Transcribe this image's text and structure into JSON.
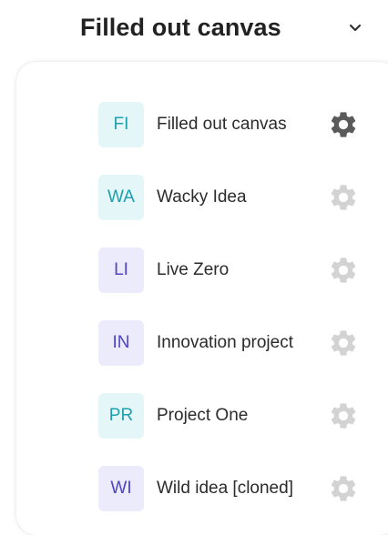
{
  "selector": {
    "label": "Filled out canvas",
    "chevron_icon": "chevron-down-icon"
  },
  "canvases": [
    {
      "initials": "FI",
      "name": "Filled out canvas",
      "badge_color": "teal",
      "settings_icon": "gear-icon",
      "settings_state": "active"
    },
    {
      "initials": "WA",
      "name": "Wacky Idea",
      "badge_color": "teal",
      "settings_icon": "gear-icon",
      "settings_state": "muted"
    },
    {
      "initials": "LI",
      "name": "Live Zero",
      "badge_color": "purple",
      "settings_icon": "gear-icon",
      "settings_state": "muted"
    },
    {
      "initials": "IN",
      "name": "Innovation project",
      "badge_color": "purple",
      "settings_icon": "gear-icon",
      "settings_state": "muted"
    },
    {
      "initials": "PR",
      "name": "Project One",
      "badge_color": "teal",
      "settings_icon": "gear-icon",
      "settings_state": "muted"
    },
    {
      "initials": "WI",
      "name": "Wild idea [cloned]",
      "badge_color": "purple",
      "settings_icon": "gear-icon",
      "settings_state": "muted"
    }
  ],
  "colors": {
    "teal_bg": "#e4f6f7",
    "teal_text": "#1f9fae",
    "purple_bg": "#ecebfc",
    "purple_text": "#4f44c8",
    "gear_active": "#5a5a5a",
    "gear_muted": "#d3d3d3"
  }
}
